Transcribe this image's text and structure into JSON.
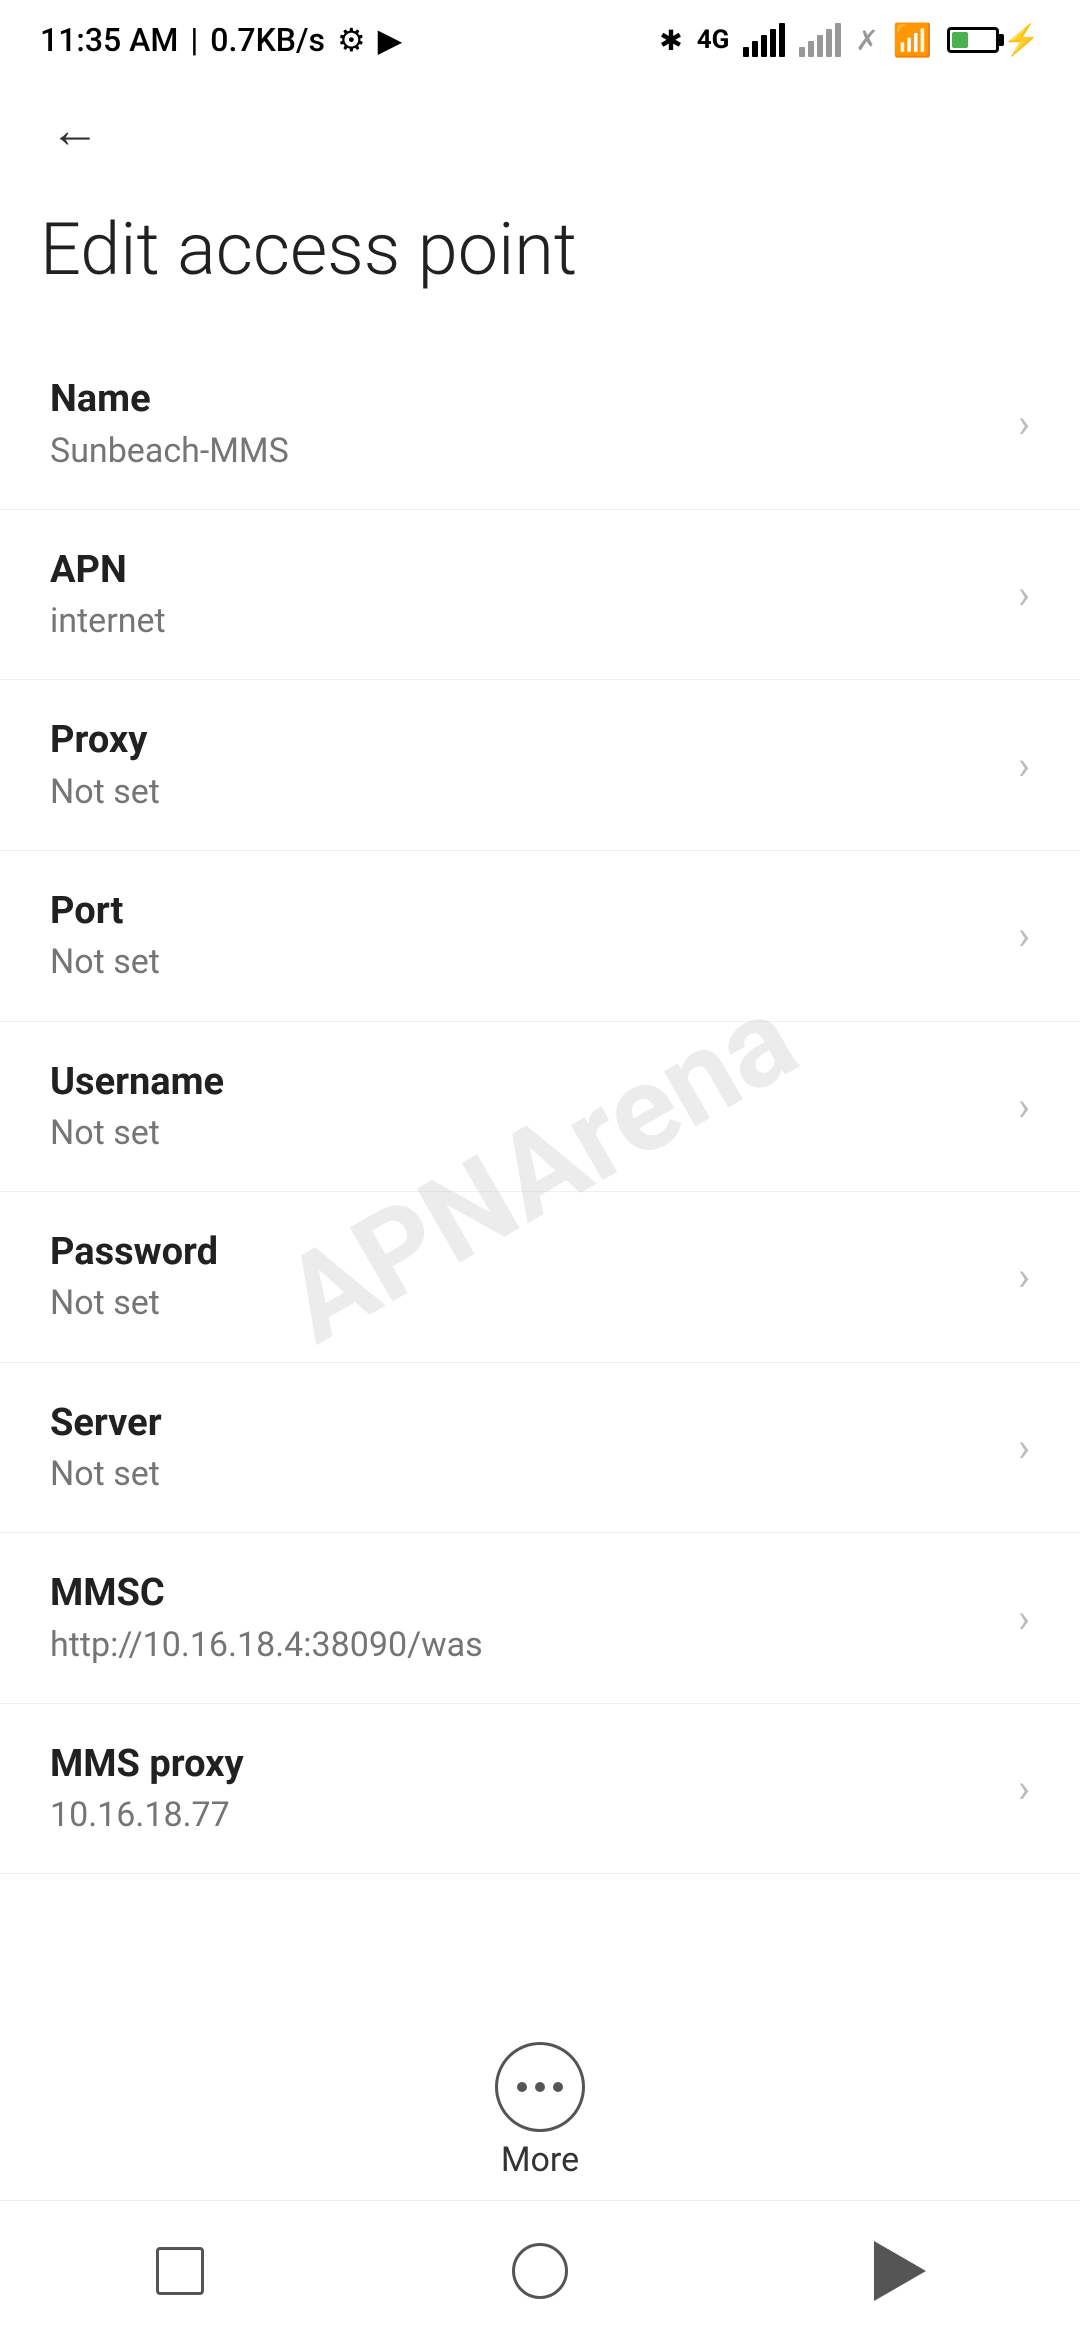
{
  "statusBar": {
    "time": "11:35 AM",
    "speed": "0.7KB/s",
    "settingsIcon": "gear-icon",
    "cameraIcon": "camera-icon",
    "bluetoothIcon": "bluetooth-icon",
    "networkType": "4G",
    "batteryPercent": "38",
    "chargingIcon": "charging-icon"
  },
  "toolbar": {
    "backLabel": "←"
  },
  "page": {
    "title": "Edit access point"
  },
  "settings": {
    "items": [
      {
        "label": "Name",
        "value": "Sunbeach-MMS"
      },
      {
        "label": "APN",
        "value": "internet"
      },
      {
        "label": "Proxy",
        "value": "Not set"
      },
      {
        "label": "Port",
        "value": "Not set"
      },
      {
        "label": "Username",
        "value": "Not set"
      },
      {
        "label": "Password",
        "value": "Not set"
      },
      {
        "label": "Server",
        "value": "Not set"
      },
      {
        "label": "MMSC",
        "value": "http://10.16.18.4:38090/was"
      },
      {
        "label": "MMS proxy",
        "value": "10.16.18.77"
      }
    ]
  },
  "bottomBar": {
    "moreLabel": "More"
  },
  "watermark": "APNArena",
  "navBar": {
    "squareLabel": "recent-apps-button",
    "circleLabel": "home-button",
    "triangleLabel": "back-button"
  }
}
